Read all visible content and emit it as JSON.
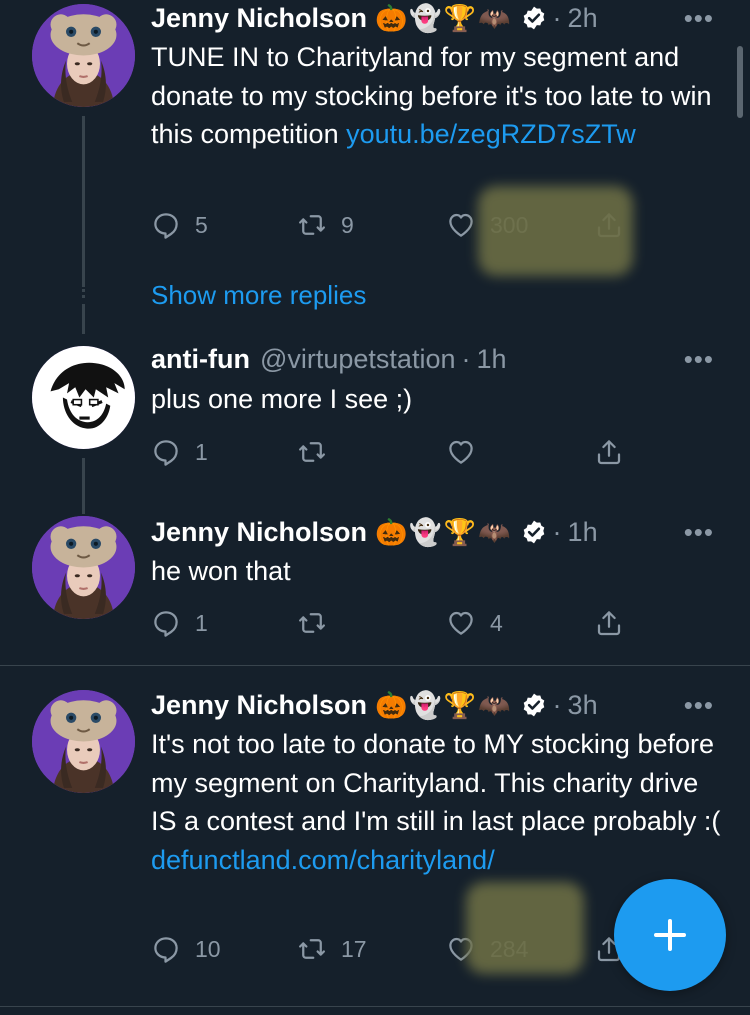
{
  "tweets": [
    {
      "name": "Jenny Nicholson",
      "emojis": "🎃👻🏆🦇",
      "verified": true,
      "handle": "",
      "time": "2h",
      "text": "TUNE IN to Charityland for my segment and donate to my stocking before it's too late to win this competition ",
      "link": "youtu.be/zegRZD7sZTw",
      "replies": "5",
      "retweets": "9",
      "likes": "300"
    },
    {
      "name": "anti-fun",
      "emojis": "",
      "verified": false,
      "handle": "@virtupetstation",
      "time": "1h",
      "text": "plus one more I see ;)",
      "link": "",
      "replies": "1",
      "retweets": "",
      "likes": ""
    },
    {
      "name": "Jenny Nicholson",
      "emojis": "🎃👻🏆🦇",
      "verified": true,
      "handle": "",
      "time": "1h",
      "text": "he won that",
      "link": "",
      "replies": "1",
      "retweets": "",
      "likes": "4"
    },
    {
      "name": "Jenny Nicholson",
      "emojis": "🎃👻🏆🦇",
      "verified": true,
      "handle": "",
      "time": "3h",
      "text": "It's not too late to donate to MY stocking before my segment on Charityland. This charity drive IS a contest and I'm still in last place probably :( ",
      "link": "defunctland.com/charityland/",
      "replies": "10",
      "retweets": "17",
      "likes": "284"
    }
  ],
  "show_more_label": "Show more replies",
  "dot": "·",
  "more_label": "•••",
  "colors": {
    "background": "#15202b",
    "text": "#ffffff",
    "muted": "#8b98a5",
    "link": "#1d9bf0",
    "divider": "#38444d",
    "fab": "#1d9bf0"
  },
  "icons": {
    "reply": "reply-icon",
    "retweet": "retweet-icon",
    "like": "heart-icon",
    "share": "share-icon",
    "verified": "verified-badge-icon",
    "compose": "plus-icon"
  }
}
